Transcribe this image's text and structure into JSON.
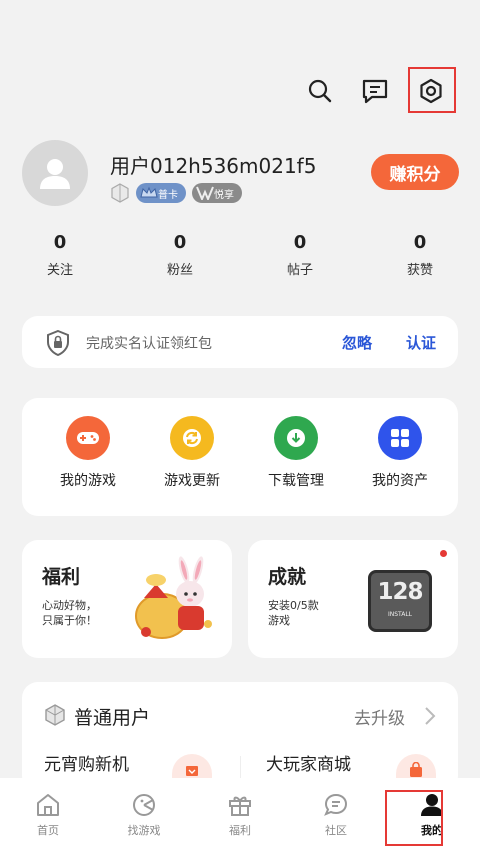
{
  "header": {
    "search_icon": "search-icon",
    "message_icon": "message-icon",
    "settings_icon": "settings-gear-icon"
  },
  "profile": {
    "username": "用户012h536m021f5",
    "badge_card": "普卡",
    "badge_vip": "悦享",
    "earn_points": "赚积分"
  },
  "stats": [
    {
      "value": "0",
      "label": "关注"
    },
    {
      "value": "0",
      "label": "粉丝"
    },
    {
      "value": "0",
      "label": "帖子"
    },
    {
      "value": "0",
      "label": "获赞"
    }
  ],
  "notice": {
    "text": "完成实名认证领红包",
    "ignore": "忽略",
    "verify": "认证"
  },
  "menu": [
    {
      "label": "我的游戏",
      "color": "#f4673a",
      "icon": "gamepad-icon"
    },
    {
      "label": "游戏更新",
      "color": "#f5b91f",
      "icon": "refresh-icon"
    },
    {
      "label": "下载管理",
      "color": "#2fa84f",
      "icon": "download-icon"
    },
    {
      "label": "我的资产",
      "color": "#2f54eb",
      "icon": "grid-icon"
    }
  ],
  "promo": {
    "welfare_title": "福利",
    "welfare_sub_1": "心动好物，",
    "welfare_sub_2": "只属于你！",
    "achievement_title": "成就",
    "achievement_sub_1": "安装0/5款",
    "achievement_sub_2": "游戏",
    "achievement_badge": "128",
    "achievement_badge_sub": "INSTALL"
  },
  "member": {
    "level": "普通用户",
    "upgrade": "去升级",
    "item1": "元宵购新机",
    "item2": "大玩家商城"
  },
  "nav": [
    {
      "label": "首页"
    },
    {
      "label": "找游戏"
    },
    {
      "label": "福利"
    },
    {
      "label": "社区"
    },
    {
      "label": "我的"
    }
  ],
  "colors": {
    "accent": "#f4673a",
    "link": "#2b57d7",
    "highlight": "#e53935"
  }
}
